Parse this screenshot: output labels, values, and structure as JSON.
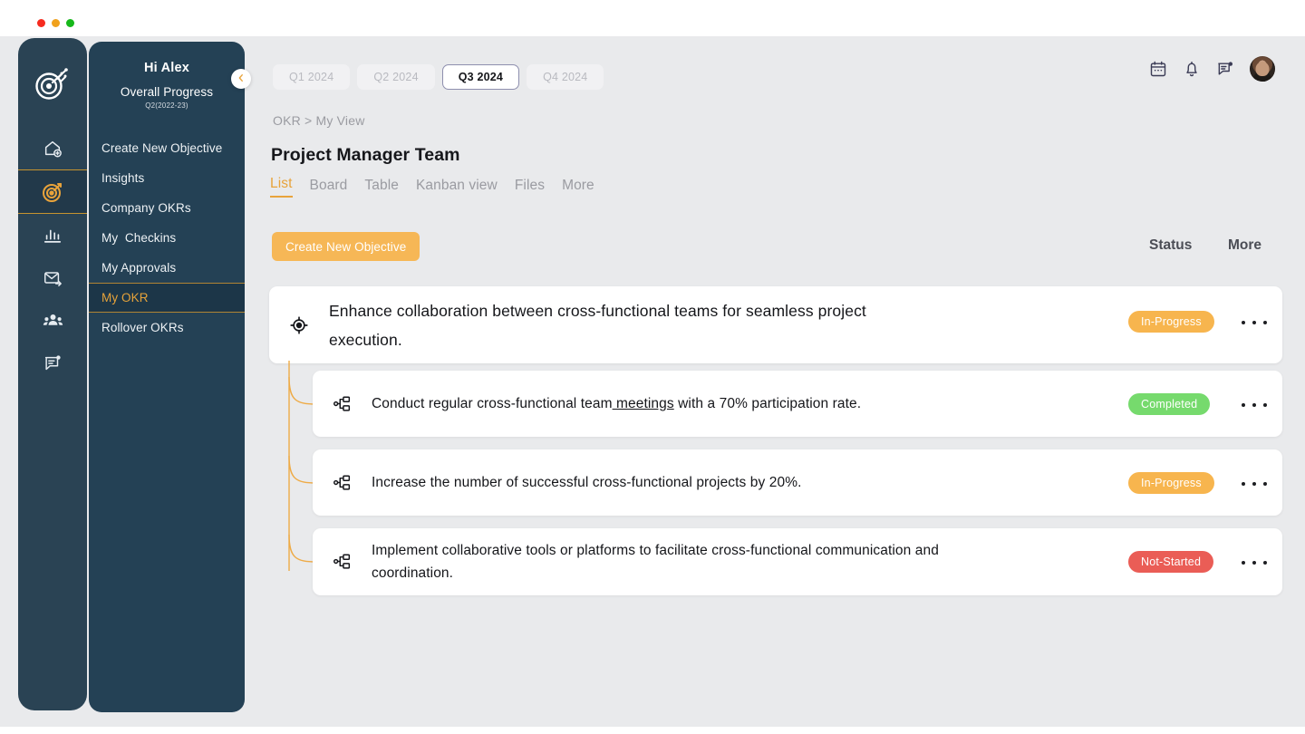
{
  "window": {
    "dots": [
      "close",
      "minimize",
      "maximize"
    ]
  },
  "rail": {
    "logo_icon": "target-arrows-logo",
    "items": [
      {
        "name": "home",
        "icon": "home-plus-icon",
        "active": false
      },
      {
        "name": "okr",
        "icon": "target-icon",
        "active": true
      },
      {
        "name": "analytics",
        "icon": "bar-chart-icon",
        "active": false
      },
      {
        "name": "messages",
        "icon": "mail-send-icon",
        "active": false
      },
      {
        "name": "teams",
        "icon": "users-icon",
        "active": false
      },
      {
        "name": "reports",
        "icon": "message-note-icon",
        "active": false
      }
    ]
  },
  "sidebar": {
    "greeting": "Hi Alex",
    "progress_label": "Overall Progress",
    "quarter_label": "Q2(2022-23)",
    "collapse_icon": "chevron-left-icon",
    "items": [
      {
        "label": "Create New Objective",
        "active": false
      },
      {
        "label": "Insights",
        "active": false
      },
      {
        "label": "Company OKRs",
        "active": false
      },
      {
        "label": "My  Checkins",
        "active": false
      },
      {
        "label": "My Approvals",
        "active": false
      },
      {
        "label": "My OKR",
        "active": true
      },
      {
        "label": "Rollover OKRs",
        "active": false
      }
    ]
  },
  "header": {
    "quarters": [
      {
        "label": "Q1 2024",
        "active": false
      },
      {
        "label": "Q2 2024",
        "active": false
      },
      {
        "label": "Q3 2024",
        "active": true
      },
      {
        "label": "Q4 2024",
        "active": false
      }
    ],
    "icons": [
      "calendar-icon",
      "bell-icon",
      "message-icon"
    ],
    "avatar": "user-avatar"
  },
  "main": {
    "breadcrumb": "OKR > My View",
    "title": "Project Manager Team",
    "tabs": [
      {
        "label": "List",
        "active": true
      },
      {
        "label": "Board",
        "active": false
      },
      {
        "label": "Table",
        "active": false
      },
      {
        "label": "Kanban view",
        "active": false
      },
      {
        "label": "Files",
        "active": false
      },
      {
        "label": "More",
        "active": false
      }
    ],
    "create_button": "Create New Objective",
    "columns": {
      "status": "Status",
      "more": "More"
    },
    "objective": {
      "icon": "target-objective-icon",
      "text": "Enhance collaboration between cross-functional teams for seamless project execution.",
      "status": "In-Progress",
      "status_color": "#f7b54e",
      "more_icon": "ellipsis-icon"
    },
    "key_results": [
      {
        "icon": "hierarchy-icon",
        "text_before": "Conduct regular cross-functional team",
        "text_underlined": " meetings",
        "text_after": " with a 70% participation rate.",
        "status": "Completed",
        "status_color": "#76da6d",
        "more_icon": "ellipsis-icon"
      },
      {
        "icon": "hierarchy-icon",
        "text_before": "Increase the number of successful cross-functional projects by 20%.",
        "text_underlined": "",
        "text_after": "",
        "status": "In-Progress",
        "status_color": "#f7b54e",
        "more_icon": "ellipsis-icon"
      },
      {
        "icon": "hierarchy-icon",
        "text_before": "Implement collaborative tools or platforms to facilitate cross-functional communication and coordination.",
        "text_underlined": "",
        "text_after": "",
        "status": "Not-Started",
        "status_color": "#ea5d56",
        "more_icon": "ellipsis-icon"
      }
    ]
  },
  "colors": {
    "accent": "#e8a33b",
    "sidebar": "#244155",
    "rail": "#2a4354",
    "page_bg": "#e9eaec",
    "connector": "#e8a33b"
  }
}
